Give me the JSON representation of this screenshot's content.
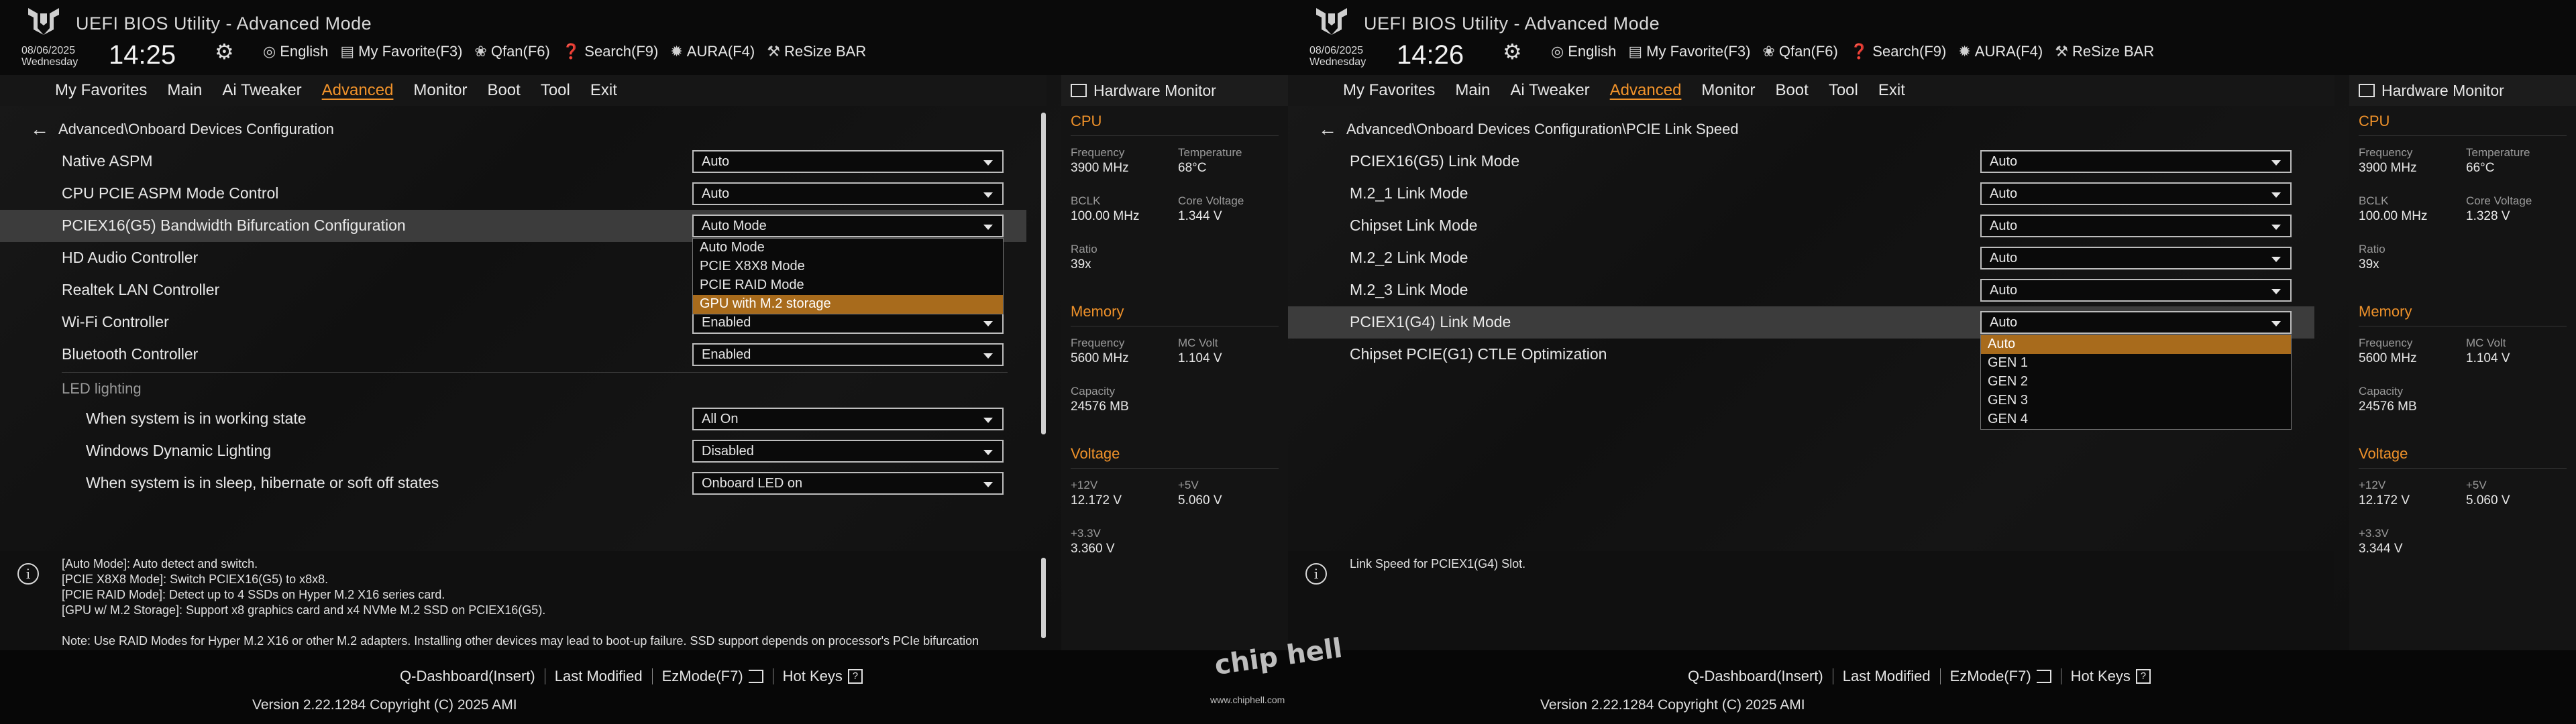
{
  "screens": [
    {
      "header": {
        "title": "UEFI BIOS Utility - Advanced Mode",
        "date": "08/06/2025",
        "day": "Wednesday",
        "time": "14:25",
        "shortcuts": [
          {
            "icon": "globe-icon",
            "label": "English"
          },
          {
            "icon": "favorite-icon",
            "label": "My Favorite(F3)"
          },
          {
            "icon": "fan-icon",
            "label": "Qfan(F6)"
          },
          {
            "icon": "search-icon",
            "label": "Search(F9)"
          },
          {
            "icon": "aura-icon",
            "label": "AURA(F4)"
          },
          {
            "icon": "resize-bar-icon",
            "label": "ReSize BAR"
          }
        ]
      },
      "menu": [
        "My Favorites",
        "Main",
        "Ai Tweaker",
        "Advanced",
        "Monitor",
        "Boot",
        "Tool",
        "Exit"
      ],
      "active_menu": "Advanced",
      "breadcrumb": "Advanced\\Onboard Devices Configuration",
      "rows": [
        {
          "label": "Native ASPM",
          "value": "Auto"
        },
        {
          "label": "CPU PCIE ASPM Mode Control",
          "value": "Auto"
        },
        {
          "label": "PCIEX16(G5) Bandwidth Bifurcation Configuration",
          "value": "Auto Mode",
          "highlight": true
        },
        {
          "label": "HD Audio Controller",
          "value": ""
        },
        {
          "label": "Realtek LAN Controller",
          "value": ""
        },
        {
          "label": "Wi-Fi Controller",
          "value": "Enabled"
        },
        {
          "label": "Bluetooth Controller",
          "value": "Enabled"
        },
        {
          "label": "LED lighting",
          "section": true
        },
        {
          "label": "When system is in working state",
          "value": "All On",
          "sub": true
        },
        {
          "label": "Windows Dynamic Lighting",
          "value": "Disabled",
          "sub": true
        },
        {
          "label": "When system is in sleep, hibernate or soft off states",
          "value": "Onboard LED on",
          "sub": true
        }
      ],
      "dropdown_open": {
        "row": 2,
        "options": [
          "Auto Mode",
          "PCIE X8X8 Mode",
          "PCIE RAID Mode",
          "GPU with M.2 storage"
        ],
        "selected": 3
      },
      "help": [
        "[Auto Mode]: Auto detect and switch.",
        "[PCIE X8X8 Mode]: Switch PCIEX16(G5) to x8x8.",
        "[PCIE RAID Mode]: Detect up to 4 SSDs on Hyper M.2 X16 series card.",
        "[GPU w/ M.2 Storage]: Support x8 graphics card and x4 NVMe M.2 SSD on PCIEX16(G5).",
        "",
        "Note: Use RAID Modes for Hyper M.2 X16 or other M.2 adapters. Installing other devices may lead to boot-up failure. SSD support depends on processor's PCIe bifurcation"
      ],
      "hw": {
        "title": "Hardware Monitor",
        "cpu_title": "CPU",
        "cpu": [
          {
            "k": "Frequency",
            "v": "3900 MHz"
          },
          {
            "k": "Temperature",
            "v": "68°C"
          },
          {
            "k": "BCLK",
            "v": "100.00 MHz"
          },
          {
            "k": "Core Voltage",
            "v": "1.344 V"
          },
          {
            "k": "Ratio",
            "v": "39x"
          }
        ],
        "mem_title": "Memory",
        "mem": [
          {
            "k": "Frequency",
            "v": "5600 MHz"
          },
          {
            "k": "MC Volt",
            "v": "1.104 V"
          },
          {
            "k": "Capacity",
            "v": "24576 MB"
          }
        ],
        "volt_title": "Voltage",
        "volt": [
          {
            "k": "+12V",
            "v": "12.172 V"
          },
          {
            "k": "+5V",
            "v": "5.060 V"
          },
          {
            "k": "+3.3V",
            "v": "3.360 V"
          }
        ]
      },
      "footer": {
        "items": [
          "Q-Dashboard(Insert)",
          "Last Modified",
          "EzMode(F7)",
          "Hot Keys"
        ],
        "version": "Version 2.22.1284 Copyright (C) 2025 AMI"
      }
    },
    {
      "header": {
        "title": "UEFI BIOS Utility - Advanced Mode",
        "date": "08/06/2025",
        "day": "Wednesday",
        "time": "14:26",
        "shortcuts": [
          {
            "icon": "globe-icon",
            "label": "English"
          },
          {
            "icon": "favorite-icon",
            "label": "My Favorite(F3)"
          },
          {
            "icon": "fan-icon",
            "label": "Qfan(F6)"
          },
          {
            "icon": "search-icon",
            "label": "Search(F9)"
          },
          {
            "icon": "aura-icon",
            "label": "AURA(F4)"
          },
          {
            "icon": "resize-bar-icon",
            "label": "ReSize BAR"
          }
        ]
      },
      "menu": [
        "My Favorites",
        "Main",
        "Ai Tweaker",
        "Advanced",
        "Monitor",
        "Boot",
        "Tool",
        "Exit"
      ],
      "active_menu": "Advanced",
      "breadcrumb": "Advanced\\Onboard Devices Configuration\\PCIE Link Speed",
      "rows": [
        {
          "label": "PCIEX16(G5) Link Mode",
          "value": "Auto"
        },
        {
          "label": "M.2_1 Link Mode",
          "value": "Auto"
        },
        {
          "label": "Chipset Link Mode",
          "value": "Auto"
        },
        {
          "label": "M.2_2 Link Mode",
          "value": "Auto"
        },
        {
          "label": "M.2_3 Link Mode",
          "value": "Auto"
        },
        {
          "label": "PCIEX1(G4) Link Mode",
          "value": "Auto",
          "highlight": true
        },
        {
          "label": "Chipset PCIE(G1) CTLE Optimization",
          "value": ""
        }
      ],
      "dropdown_open": {
        "row": 5,
        "options": [
          "Auto",
          "GEN 1",
          "GEN 2",
          "GEN 3",
          "GEN 4"
        ],
        "selected": 0
      },
      "help": [
        "Link Speed for PCIEX1(G4) Slot."
      ],
      "hw": {
        "title": "Hardware Monitor",
        "cpu_title": "CPU",
        "cpu": [
          {
            "k": "Frequency",
            "v": "3900 MHz"
          },
          {
            "k": "Temperature",
            "v": "66°C"
          },
          {
            "k": "BCLK",
            "v": "100.00 MHz"
          },
          {
            "k": "Core Voltage",
            "v": "1.328 V"
          },
          {
            "k": "Ratio",
            "v": "39x"
          }
        ],
        "mem_title": "Memory",
        "mem": [
          {
            "k": "Frequency",
            "v": "5600 MHz"
          },
          {
            "k": "MC Volt",
            "v": "1.104 V"
          },
          {
            "k": "Capacity",
            "v": "24576 MB"
          }
        ],
        "volt_title": "Voltage",
        "volt": [
          {
            "k": "+12V",
            "v": "12.172 V"
          },
          {
            "k": "+5V",
            "v": "5.060 V"
          },
          {
            "k": "+3.3V",
            "v": "3.344 V"
          }
        ]
      },
      "footer": {
        "items": [
          "Q-Dashboard(Insert)",
          "Last Modified",
          "EzMode(F7)",
          "Hot Keys"
        ],
        "version": "Version 2.22.1284 Copyright (C) 2025 AMI"
      }
    }
  ],
  "watermark": {
    "text": "chip hell",
    "url": "www.chiphell.com"
  }
}
